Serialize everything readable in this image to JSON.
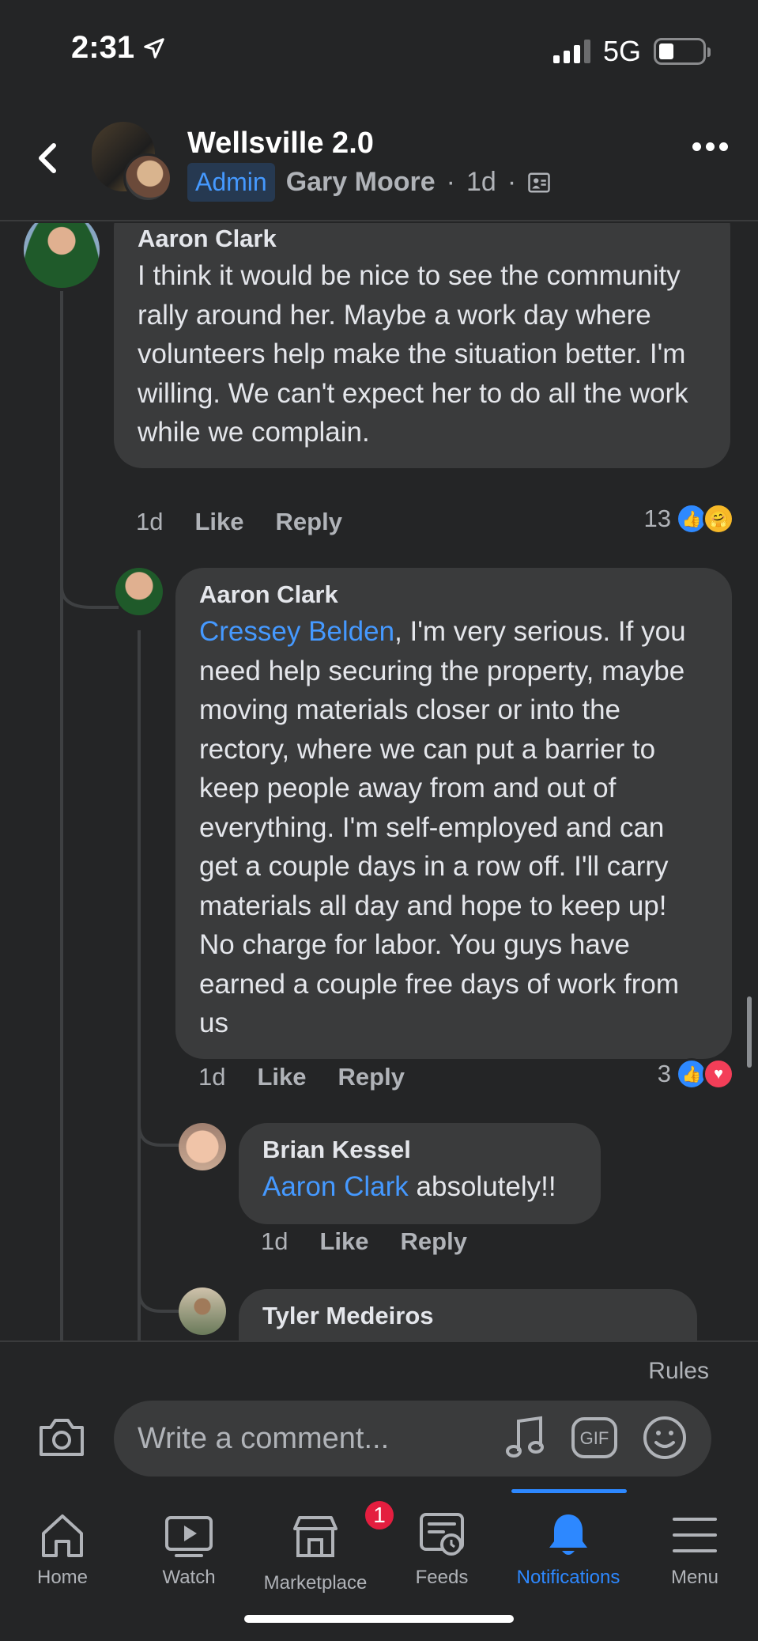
{
  "status_bar": {
    "time": "2:31",
    "network": "5G"
  },
  "header": {
    "group_name": "Wellsville 2.0",
    "admin_label": "Admin",
    "author": "Gary Moore",
    "separator": "·",
    "age": "1d"
  },
  "comments": [
    {
      "name": "Aaron Clark",
      "text": "I think it would be nice to see the community rally around her.  Maybe a work day where volunteers help make the situation better.  I'm willing.  We can't expect her to do all the work while we complain.",
      "time": "1d",
      "like": "Like",
      "reply": "Reply",
      "reaction_count": "13"
    },
    {
      "name": "Aaron Clark",
      "mention": "Cressey Belden",
      "text": ", I'm very serious.  If you need help securing the property, maybe moving materials closer or into the rectory, where we can put a barrier to keep people away from and out of everything.  I'm self-employed and can get a couple days in a row off.  I'll carry materials all day and hope to keep up!  No charge for labor.  You guys have earned a couple free days of work from us",
      "time": "1d",
      "like": "Like",
      "reply": "Reply",
      "reaction_count": "3"
    },
    {
      "name": "Brian Kessel",
      "mention": "Aaron Clark",
      "text": " absolutely!!",
      "time": "1d",
      "like": "Like",
      "reply": "Reply"
    },
    {
      "name": "Tyler Medeiros"
    }
  ],
  "composer": {
    "rules_label": "Rules",
    "placeholder": "Write a comment..."
  },
  "nav": {
    "items": [
      {
        "label": "Home"
      },
      {
        "label": "Watch"
      },
      {
        "label": "Marketplace",
        "badge": "1"
      },
      {
        "label": "Feeds"
      },
      {
        "label": "Notifications"
      },
      {
        "label": "Menu"
      }
    ]
  },
  "colors": {
    "background": "#242526",
    "bubble": "#3a3b3c",
    "accent": "#2d88ff",
    "mention": "#4599ff",
    "badge": "#e41e3f"
  }
}
